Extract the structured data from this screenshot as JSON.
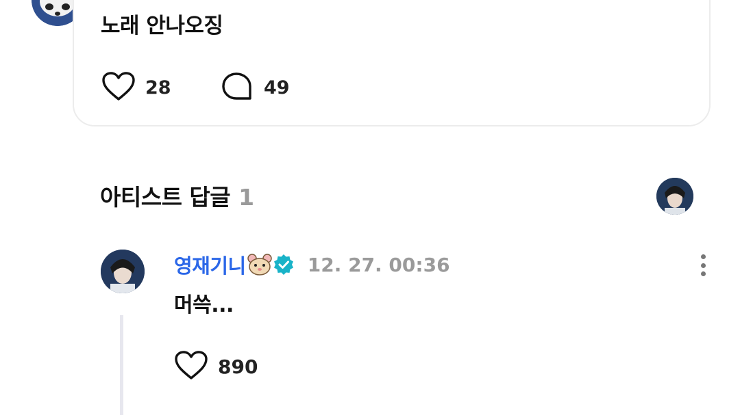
{
  "post": {
    "text": "노래 안나오징",
    "like_count": "28",
    "comment_count": "49"
  },
  "artist_replies": {
    "title": "아티스트 답글",
    "count": "1"
  },
  "reply": {
    "author": "영재기니",
    "time": "12. 27. 00:36",
    "text": "머쓱...",
    "like_count": "890"
  },
  "colors": {
    "author_name": "#2b67e8",
    "verified_badge": "#19b3c8",
    "muted_text": "#9a9a9a"
  },
  "icons": {
    "like": "heart-outline-icon",
    "comment": "speech-bubble-outline-icon",
    "verified": "verified-badge-icon",
    "emoji": "hamster-emoji-icon",
    "more": "vertical-ellipsis-icon"
  }
}
